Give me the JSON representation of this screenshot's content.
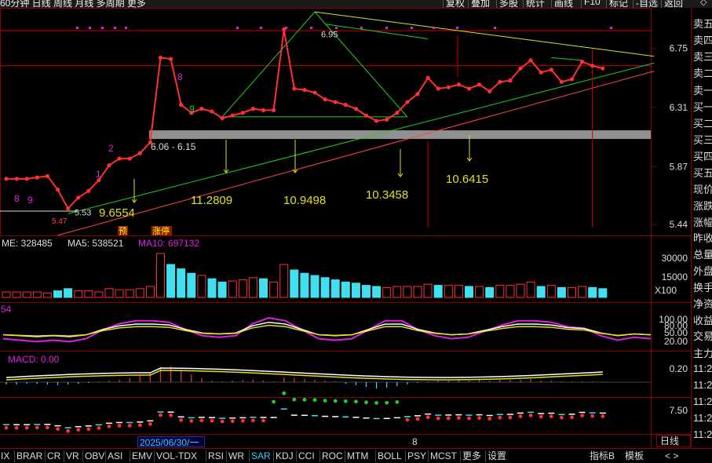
{
  "toolbar": {
    "left_text": "60分钟  日线  周线  月线  多周期  更多",
    "items": [
      "复权",
      "叠加",
      "多股",
      "统计",
      "画线",
      "F10",
      "标记",
      "-自选",
      "返回"
    ]
  },
  "price_axis": {
    "labels": [
      "6.75",
      "6.31",
      "5.87",
      "5.44"
    ]
  },
  "annotations": {
    "pivot_high": "6.95",
    "low_label": "5.53",
    "low_price": "5.47",
    "band": "6.06 - 6.15",
    "wave_nums": [
      "8",
      "9",
      "1",
      "2",
      "8",
      "9"
    ],
    "targets": [
      "9.6554",
      "11.2809",
      "10.9498",
      "10.3458",
      "10.6415"
    ],
    "badges": [
      "预",
      "涨停"
    ]
  },
  "volume": {
    "header": "ME: 328485",
    "ma5": "MA5: 538521",
    "ma10": "MA10: 697132",
    "axis": [
      "30000",
      "15000"
    ],
    "unit": "X100"
  },
  "kdj": {
    "header": "54",
    "axis": [
      "100.00",
      "80.00",
      "50.00",
      "20.00"
    ]
  },
  "macd": {
    "header": "MACD: 0.00",
    "axis": [
      "0.20"
    ]
  },
  "sar": {
    "axis": [
      "7.50"
    ]
  },
  "date_label": "2025/06/30/一",
  "x_tick": "8",
  "right_panel": [
    "卖五",
    "卖四",
    "卖三",
    "卖二",
    "卖一",
    "买一",
    "买二",
    "买三",
    "买四",
    "买五",
    "现价",
    "涨跌",
    "涨幅",
    "昨收",
    "总量",
    "外盘",
    "换手",
    "净资",
    "收益",
    "交易",
    "主力",
    "11:2",
    "11:2",
    "11:2",
    "11:2",
    "11:2",
    "11:2",
    "11:2",
    "11:2"
  ],
  "bottom_tabs": [
    "IX",
    "BRAR",
    "CR",
    "VR",
    "OBV",
    "ASI",
    "EMV",
    "VOL-TDX",
    "RSI",
    "WR",
    "SAR",
    "KDJ",
    "CCI",
    "ROC",
    "MTM",
    "BOLL",
    "PSY",
    "MCST",
    "更多",
    "设置"
  ],
  "bottom_right": [
    "指标B",
    "模板"
  ],
  "daily_label": "日线",
  "nav_arrows": "<  >",
  "colors": {
    "price_line": "#ff3030",
    "up_bar": "#ff3030",
    "down_bar": "#40e0f0",
    "green_line": "#20d020",
    "yellow_line": "#e0e020",
    "magenta": "#e020e0",
    "band": "#909090"
  },
  "chart_data": {
    "type": "line",
    "price": [
      5.78,
      5.78,
      5.78,
      5.79,
      5.8,
      5.7,
      5.56,
      5.64,
      5.69,
      5.77,
      5.88,
      5.93,
      5.93,
      5.97,
      6.05,
      6.68,
      6.67,
      6.33,
      6.27,
      6.3,
      6.28,
      6.23,
      6.25,
      6.27,
      6.3,
      6.29,
      6.29,
      6.89,
      6.45,
      6.44,
      6.42,
      6.37,
      6.35,
      6.33,
      6.3,
      6.25,
      6.21,
      6.22,
      6.27,
      6.35,
      6.41,
      6.53,
      6.45,
      6.46,
      6.48,
      6.45,
      6.48,
      6.43,
      6.5,
      6.51,
      6.6,
      6.66,
      6.57,
      6.59,
      6.5,
      6.52,
      6.65,
      6.62,
      6.6
    ],
    "ylim": [
      5.4,
      7.05
    ]
  }
}
